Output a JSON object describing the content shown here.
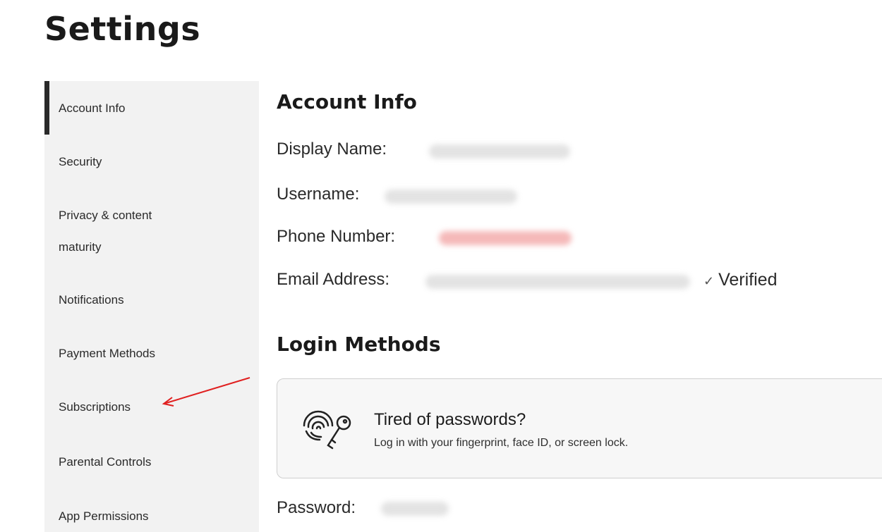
{
  "page_title": "Settings",
  "sidebar": {
    "items": [
      {
        "label": "Account Info",
        "active": true
      },
      {
        "label": "Security"
      },
      {
        "label": "Privacy & content"
      },
      {
        "label": "maturity"
      },
      {
        "label": "Notifications"
      },
      {
        "label": "Payment Methods"
      },
      {
        "label": "Subscriptions"
      },
      {
        "label": "Parental Controls"
      },
      {
        "label": "App Permissions"
      }
    ]
  },
  "account_info": {
    "title": "Account Info",
    "display_name_label": "Display Name:",
    "username_label": "Username:",
    "phone_label": "Phone Number:",
    "email_label": "Email Address:",
    "verified_label": "Verified"
  },
  "login_methods": {
    "title": "Login Methods",
    "card_title": "Tired of passwords?",
    "card_subtitle": "Log in with your fingerprint, face ID, or screen lock.",
    "password_label": "Password:"
  },
  "colors": {
    "active_indicator": "#2a2a2a",
    "sidebar_bg": "#f2f2f2",
    "annotation_arrow": "#e02020"
  },
  "icons": {
    "passwordless": "fingerprint-key-icon",
    "verified": "check-icon"
  }
}
